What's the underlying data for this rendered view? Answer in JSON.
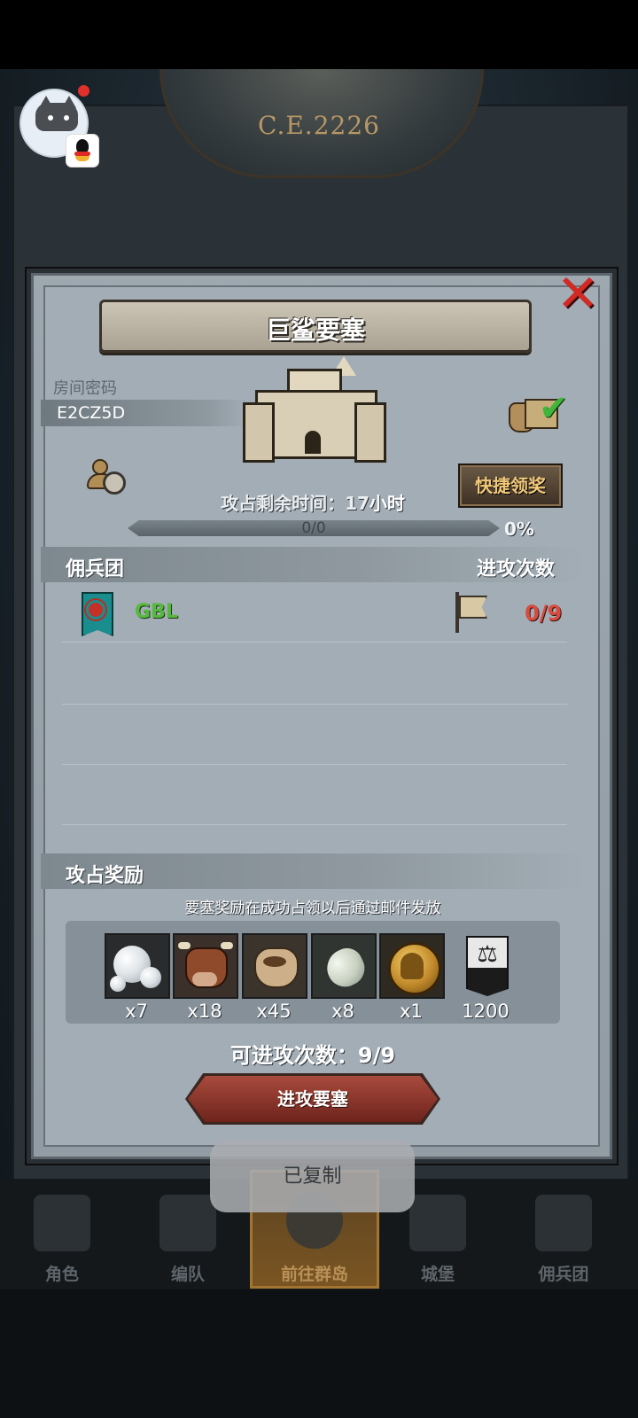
{
  "background": {
    "year": "C.E.2226"
  },
  "dialog": {
    "title": "巨鲨要塞",
    "close_icon": "close-x-icon",
    "room_label": "房间密码",
    "room_code": "E2CZ5D",
    "quick_claim_label": "快捷领奖",
    "remain_prefix": "攻占剩余时间：",
    "remain_value": "17",
    "remain_unit": "小时",
    "progress_text": "0/0",
    "progress_fraction": 0,
    "percent_text": "0%",
    "mercenary_header": "佣兵团",
    "attack_header": "进攻次数",
    "guild_name": "GBL",
    "guild_attack_count": "0/9",
    "rewards_header": "攻占奖励",
    "rewards_note": "要塞奖励在成功占领以后通过邮件发放",
    "rewards": [
      {
        "icon": "pearl-icon",
        "qty": "x7"
      },
      {
        "icon": "cow-icon",
        "qty": "x18"
      },
      {
        "icon": "sack-icon",
        "qty": "x45"
      },
      {
        "icon": "stone-icon",
        "qty": "x8"
      },
      {
        "icon": "medal-icon",
        "qty": "x1"
      },
      {
        "icon": "justice-banner-icon",
        "qty": "1200"
      }
    ],
    "attacks_available": "可进攻次数：9/9",
    "attack_button_label": "进攻要塞"
  },
  "toast": "已复制",
  "nav": [
    {
      "label": "角色"
    },
    {
      "label": "编队"
    },
    {
      "label": "前往群岛",
      "active": true
    },
    {
      "label": "城堡"
    },
    {
      "label": "佣兵团"
    }
  ],
  "colors": {
    "guild_name": "#56b83c",
    "attack_count": "#d84c3f",
    "quick_claim_text": "#f2c97a",
    "close": "#d12a24"
  }
}
